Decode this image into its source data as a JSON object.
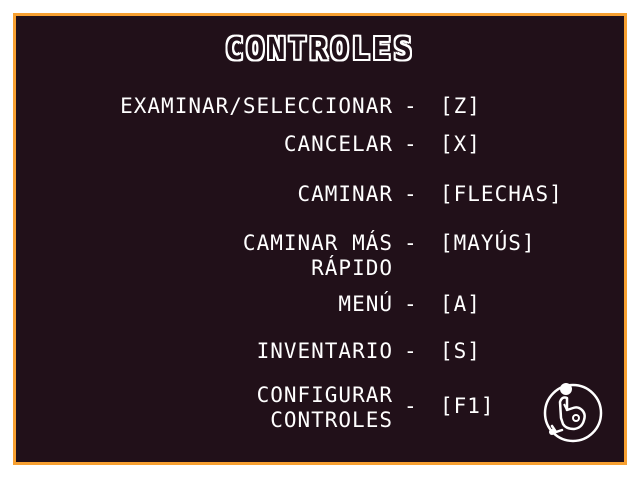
{
  "title": "CONTROLES",
  "separator": "-",
  "controls": [
    {
      "action": "EXAMINAR/SELECCIONAR",
      "key": "[Z]"
    },
    {
      "action": "CANCELAR",
      "key": "[X]"
    },
    {
      "action": "CAMINAR",
      "key": "[FLECHAS]"
    },
    {
      "action_line1": "CAMINAR MÁS",
      "action_line2": "RÁPIDO",
      "key": "[MAYÚS]"
    },
    {
      "action": "MENÚ",
      "key": "[A]"
    },
    {
      "action": "INVENTARIO",
      "key": "[S]"
    },
    {
      "action_line1": "CONFIGURAR",
      "action_line2": "CONTROLES",
      "key": "[F1]"
    }
  ],
  "colors": {
    "background": "#211019",
    "border": "#f7a031",
    "text": "#ffffff"
  },
  "icons": {
    "corner": "pointing-hand-bubble-icon"
  }
}
